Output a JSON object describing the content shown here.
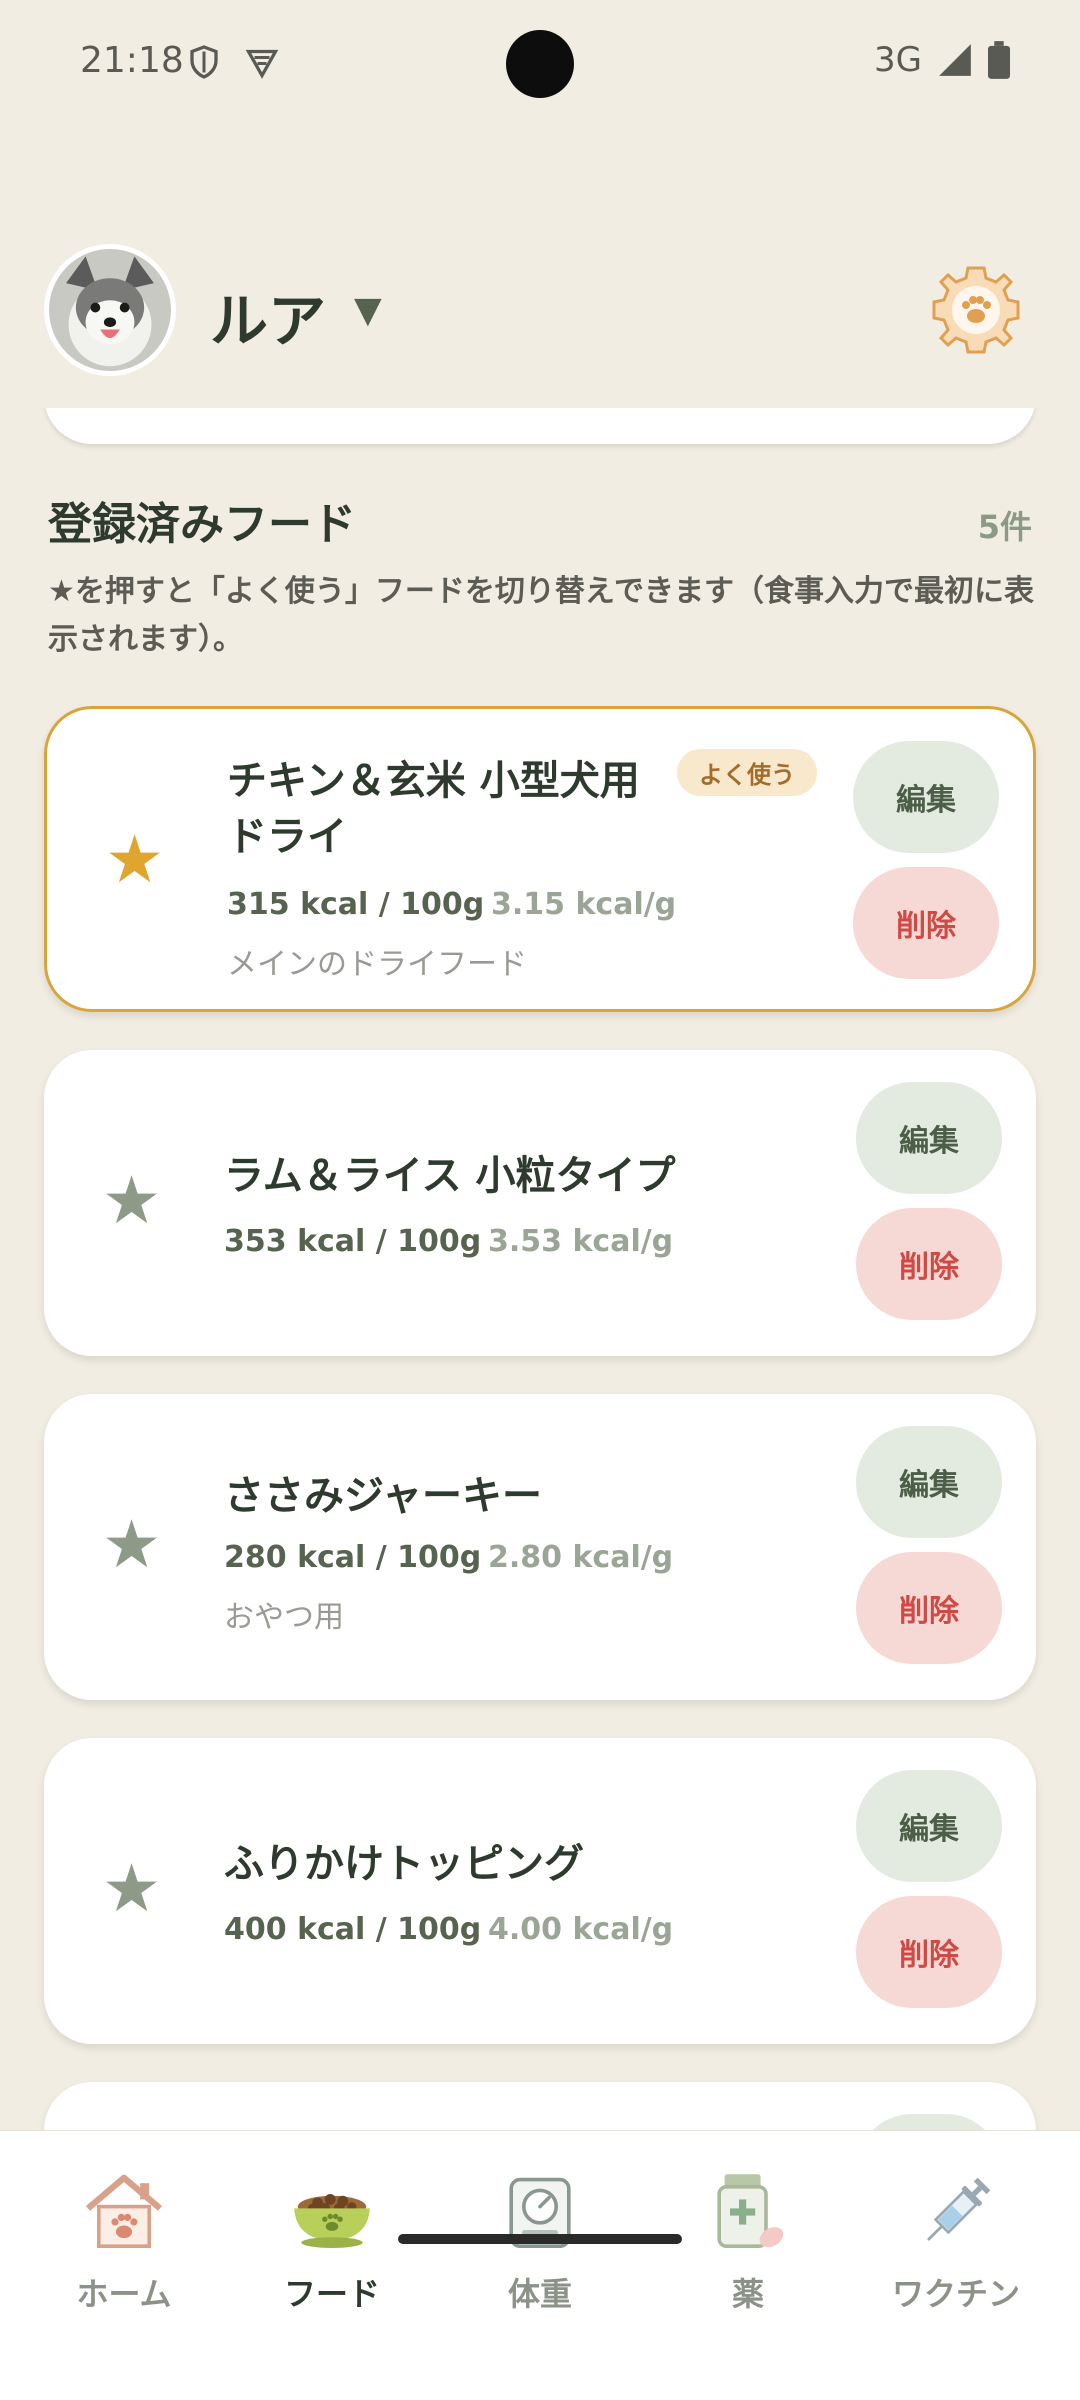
{
  "status_bar": {
    "time": "21:18",
    "network": "3G"
  },
  "header": {
    "pet_name": "ルア",
    "dropdown_glyph": "▼",
    "settings_icon": "paw-gear-icon"
  },
  "section": {
    "title": "登録済みフード",
    "count": "5件",
    "description": "★を押すと「よく使う」フードを切り替えできます（食事入力で最初に表示されます）。"
  },
  "foods": [
    {
      "name": "チキン＆玄米 小型犬用ドライ",
      "kcal": "315 kcal",
      "per": " / 100g",
      "kcal_per_g": "3.15 kcal/g",
      "note": "メインのドライフード",
      "favorite": true,
      "badge": "よく使う",
      "edit_label": "編集",
      "delete_label": "削除"
    },
    {
      "name": "ラム＆ライス 小粒タイプ",
      "kcal": "353 kcal",
      "per": " / 100g",
      "kcal_per_g": "3.53 kcal/g",
      "note": "",
      "favorite": false,
      "edit_label": "編集",
      "delete_label": "削除"
    },
    {
      "name": "ささみジャーキー",
      "kcal": "280 kcal",
      "per": " / 100g",
      "kcal_per_g": "2.80 kcal/g",
      "note": "おやつ用",
      "favorite": false,
      "edit_label": "編集",
      "delete_label": "削除"
    },
    {
      "name": "ふりかけトッピング",
      "kcal": "400 kcal",
      "per": " / 100g",
      "kcal_per_g": "4.00 kcal/g",
      "note": "",
      "favorite": false,
      "edit_label": "編集",
      "delete_label": "削除"
    }
  ],
  "star_glyph": "★",
  "colors": {
    "background": "#f1ede3",
    "favorite_star": "#e0a52e",
    "star_inactive": "#8e9a88",
    "delete": "#d04a45",
    "edit": "#4d5e48"
  },
  "nav": [
    {
      "label": "ホーム",
      "icon": "house-paw-icon",
      "active": false
    },
    {
      "label": "フード",
      "icon": "food-bowl-icon",
      "active": true
    },
    {
      "label": "体重",
      "icon": "scale-icon",
      "active": false
    },
    {
      "label": "薬",
      "icon": "medicine-bottle-icon",
      "active": false
    },
    {
      "label": "ワクチン",
      "icon": "syringe-icon",
      "active": false
    }
  ]
}
